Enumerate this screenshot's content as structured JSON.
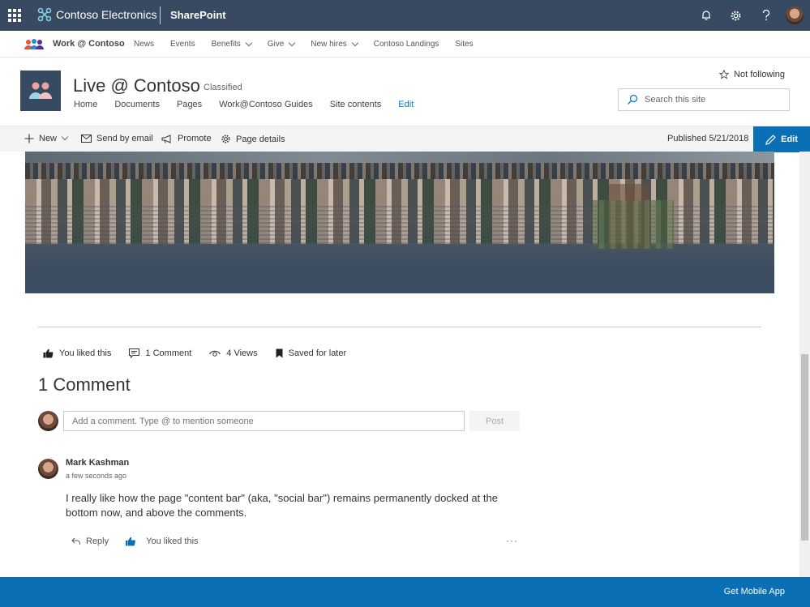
{
  "suite": {
    "brand": "Contoso Electronics",
    "app": "SharePoint"
  },
  "hub": {
    "title": "Work @ Contoso",
    "links": [
      {
        "label": "News",
        "dropdown": false
      },
      {
        "label": "Events",
        "dropdown": false
      },
      {
        "label": "Benefits",
        "dropdown": true
      },
      {
        "label": "Give",
        "dropdown": true
      },
      {
        "label": "New hires",
        "dropdown": true
      },
      {
        "label": "Contoso Landings",
        "dropdown": false
      },
      {
        "label": "Sites",
        "dropdown": false
      }
    ]
  },
  "site": {
    "title": "Live @ Contoso",
    "classification": "Classified",
    "nav": [
      "Home",
      "Documents",
      "Pages",
      "Work@Contoso Guides",
      "Site contents",
      "Edit"
    ],
    "follow_label": "Not following",
    "search_placeholder": "Search this site"
  },
  "commandbar": {
    "new_label": "New",
    "send_label": "Send by email",
    "promote_label": "Promote",
    "details_label": "Page details",
    "published": "Published 5/21/2018",
    "edit_label": "Edit"
  },
  "social": {
    "liked": "You liked this",
    "comments": "1 Comment",
    "views": "4 Views",
    "saved": "Saved for later"
  },
  "comments": {
    "title": "1 Comment",
    "input_placeholder": "Add a comment. Type @ to mention someone",
    "post_label": "Post",
    "items": [
      {
        "author": "Mark Kashman",
        "time": "a few seconds ago",
        "text": "I really like how the page \"content bar\" (aka, \"social bar\") remains permanently docked at the bottom now, and above the comments.",
        "reply_label": "Reply",
        "liked_label": "You liked this"
      }
    ]
  },
  "footer": {
    "mobile_link": "Get Mobile App"
  },
  "colors": {
    "suitebar": "#374a61",
    "accent": "#0a6fb5",
    "link": "#0078d4"
  },
  "icons": [
    "waffle-icon",
    "notifications-icon",
    "settings-icon",
    "help-icon",
    "star-icon",
    "search-icon",
    "plus-icon",
    "mail-icon",
    "megaphone-icon",
    "gear-icon",
    "pencil-icon",
    "thumbs-up-icon",
    "comment-icon",
    "eye-icon",
    "bookmark-icon",
    "reply-icon",
    "more-icon"
  ]
}
